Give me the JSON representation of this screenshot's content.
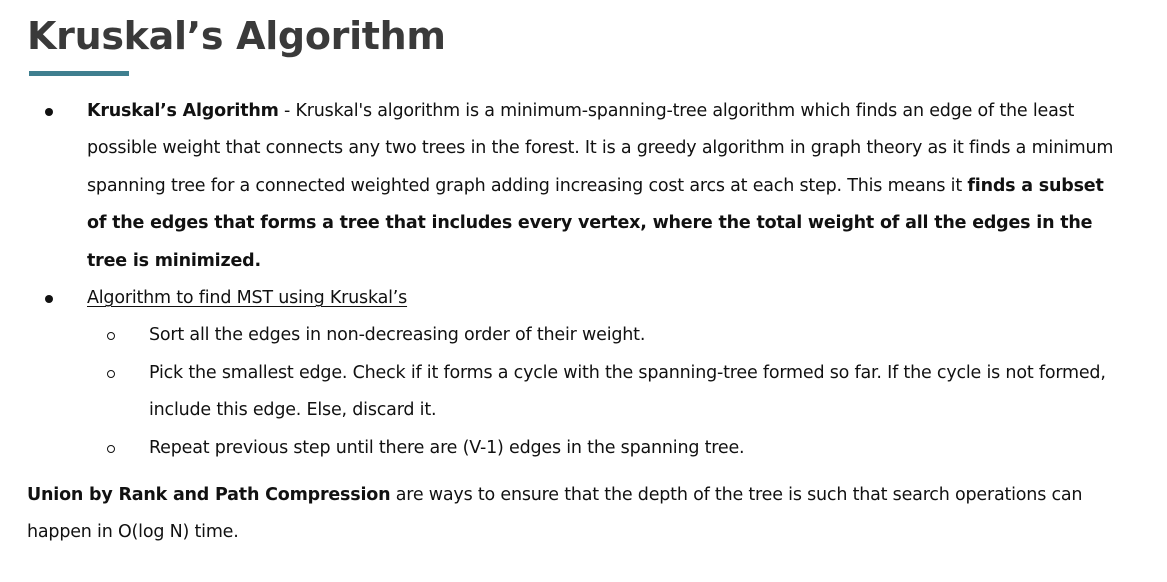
{
  "title": "Kruskal’s Algorithm",
  "accent_color": "#3f7f8f",
  "bullets": {
    "intro": {
      "term": "Kruskal’s Algorithm",
      "text_1": " - Kruskal's algorithm is a minimum-spanning-tree algorithm which finds an edge of the least possible weight that connects any two trees in the forest. It is a greedy algorithm in graph theory as it finds a minimum spanning tree for a connected weighted graph adding increasing cost arcs at each step. This means it ",
      "emphasis": "finds a subset of the edges that forms a tree that includes every vertex, where the total weight of all the edges in the tree is minimized."
    },
    "algorithm": {
      "heading": "Algorithm to find MST using Kruskal’s",
      "steps": [
        "Sort all the edges in non-decreasing order of their weight.",
        "Pick the smallest edge. Check if it forms a cycle with the spanning-tree formed so far. If the cycle is not formed, include this edge. Else, discard it.",
        "Repeat previous step until there are (V-1) edges in the spanning tree."
      ]
    }
  },
  "footer": {
    "term": "Union by Rank and Path Compression",
    "text": " are ways to ensure that the depth of the tree is such that search operations can happen in O(log N) time."
  }
}
